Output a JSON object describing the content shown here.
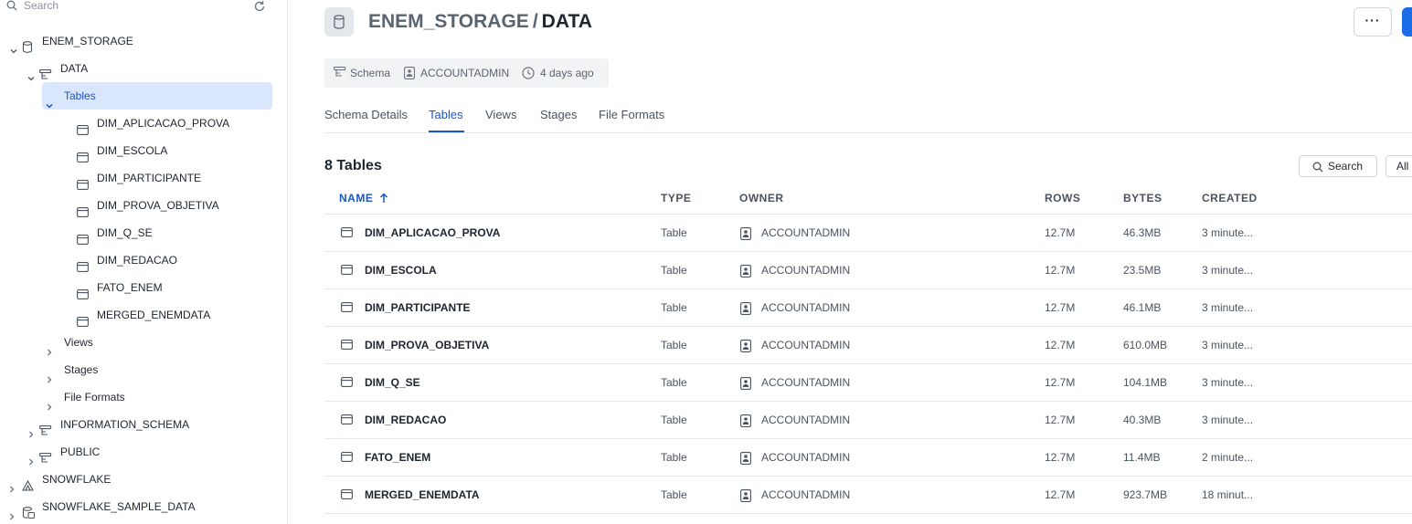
{
  "sidebar": {
    "search_label": "Search",
    "tree": [
      {
        "label": "ENEM_STORAGE",
        "expanded": true,
        "icon": "database-icon"
      },
      {
        "label": "DATA",
        "expanded": true,
        "icon": "schema-icon"
      },
      {
        "label": "Tables",
        "expanded": true,
        "selected": true
      },
      {
        "label": "DIM_APLICACAO_PROVA",
        "icon": "table-icon"
      },
      {
        "label": "DIM_ESCOLA",
        "icon": "table-icon"
      },
      {
        "label": "DIM_PARTICIPANTE",
        "icon": "table-icon"
      },
      {
        "label": "DIM_PROVA_OBJETIVA",
        "icon": "table-icon"
      },
      {
        "label": "DIM_Q_SE",
        "icon": "table-icon"
      },
      {
        "label": "DIM_REDACAO",
        "icon": "table-icon"
      },
      {
        "label": "FATO_ENEM",
        "icon": "table-icon"
      },
      {
        "label": "MERGED_ENEMDATA",
        "icon": "table-icon"
      },
      {
        "label": "Views",
        "expanded": false
      },
      {
        "label": "Stages",
        "expanded": false
      },
      {
        "label": "File Formats",
        "expanded": false
      },
      {
        "label": "INFORMATION_SCHEMA",
        "expanded": false,
        "icon": "schema-icon"
      },
      {
        "label": "PUBLIC",
        "expanded": false,
        "icon": "schema-icon"
      },
      {
        "label": "SNOWFLAKE",
        "expanded": false,
        "icon": "shared-database-icon"
      },
      {
        "label": "SNOWFLAKE_SAMPLE_DATA",
        "expanded": false,
        "icon": "sample-database-icon"
      }
    ]
  },
  "header": {
    "database": "ENEM_STORAGE",
    "separator": "/",
    "schema": "DATA",
    "more_label": "···"
  },
  "meta": {
    "type": "Schema",
    "owner": "ACCOUNTADMIN",
    "created": "4 days ago"
  },
  "tabs": [
    {
      "label": "Schema Details",
      "active": false
    },
    {
      "label": "Tables",
      "active": true
    },
    {
      "label": "Views",
      "active": false
    },
    {
      "label": "Stages",
      "active": false
    },
    {
      "label": "File Formats",
      "active": false
    }
  ],
  "table_section": {
    "count_label": "8 Tables",
    "search_label": "Search",
    "filter_label": "All"
  },
  "columns": [
    "NAME",
    "TYPE",
    "OWNER",
    "ROWS",
    "BYTES",
    "CREATED"
  ],
  "rows": [
    {
      "name": "DIM_APLICACAO_PROVA",
      "type": "Table",
      "owner": "ACCOUNTADMIN",
      "rows": "12.7M",
      "bytes": "46.3MB",
      "created": "3 minute..."
    },
    {
      "name": "DIM_ESCOLA",
      "type": "Table",
      "owner": "ACCOUNTADMIN",
      "rows": "12.7M",
      "bytes": "23.5MB",
      "created": "3 minute..."
    },
    {
      "name": "DIM_PARTICIPANTE",
      "type": "Table",
      "owner": "ACCOUNTADMIN",
      "rows": "12.7M",
      "bytes": "46.1MB",
      "created": "3 minute..."
    },
    {
      "name": "DIM_PROVA_OBJETIVA",
      "type": "Table",
      "owner": "ACCOUNTADMIN",
      "rows": "12.7M",
      "bytes": "610.0MB",
      "created": "3 minute..."
    },
    {
      "name": "DIM_Q_SE",
      "type": "Table",
      "owner": "ACCOUNTADMIN",
      "rows": "12.7M",
      "bytes": "104.1MB",
      "created": "3 minute..."
    },
    {
      "name": "DIM_REDACAO",
      "type": "Table",
      "owner": "ACCOUNTADMIN",
      "rows": "12.7M",
      "bytes": "40.3MB",
      "created": "3 minute..."
    },
    {
      "name": "FATO_ENEM",
      "type": "Table",
      "owner": "ACCOUNTADMIN",
      "rows": "12.7M",
      "bytes": "11.4MB",
      "created": "2 minute..."
    },
    {
      "name": "MERGED_ENEMDATA",
      "type": "Table",
      "owner": "ACCOUNTADMIN",
      "rows": "12.7M",
      "bytes": "923.7MB",
      "created": "18 minut..."
    }
  ],
  "colors": {
    "accent": "#1a56c7",
    "primary_button": "#1a6ce7",
    "selected_bg": "#d9e6fb"
  }
}
